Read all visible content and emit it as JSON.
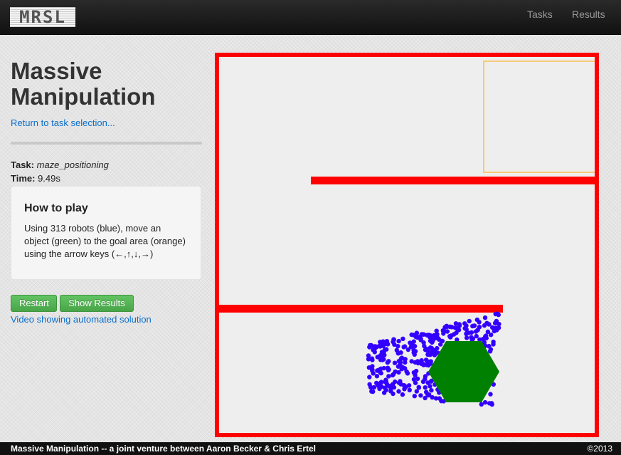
{
  "nav": {
    "logo_text": "MRSL",
    "links": [
      "Tasks",
      "Results"
    ]
  },
  "sidebar": {
    "title": "Massive Manipulation",
    "return_link": "Return to task selection...",
    "task_label": "Task:",
    "task_value": "maze_positioning",
    "time_label": "Time:",
    "time_value": "9.49s",
    "howto_title": "How to play",
    "howto_text": "Using 313 robots (blue), move an object (green) to the goal area (orange) using the arrow keys (←,↑,↓,→)",
    "restart_label": "Restart",
    "results_label": "Show Results",
    "video_link": "Video showing automated solution"
  },
  "game": {
    "robot_count": 313,
    "colors": {
      "walls": "#ff0000",
      "robots": "#3300ff",
      "object": "#008000",
      "goal": "#ffa500",
      "field": "#eeeeee"
    }
  },
  "footer": {
    "left": "Massive Manipulation -- a joint venture between Aaron Becker & Chris Ertel",
    "right": "©2013"
  }
}
